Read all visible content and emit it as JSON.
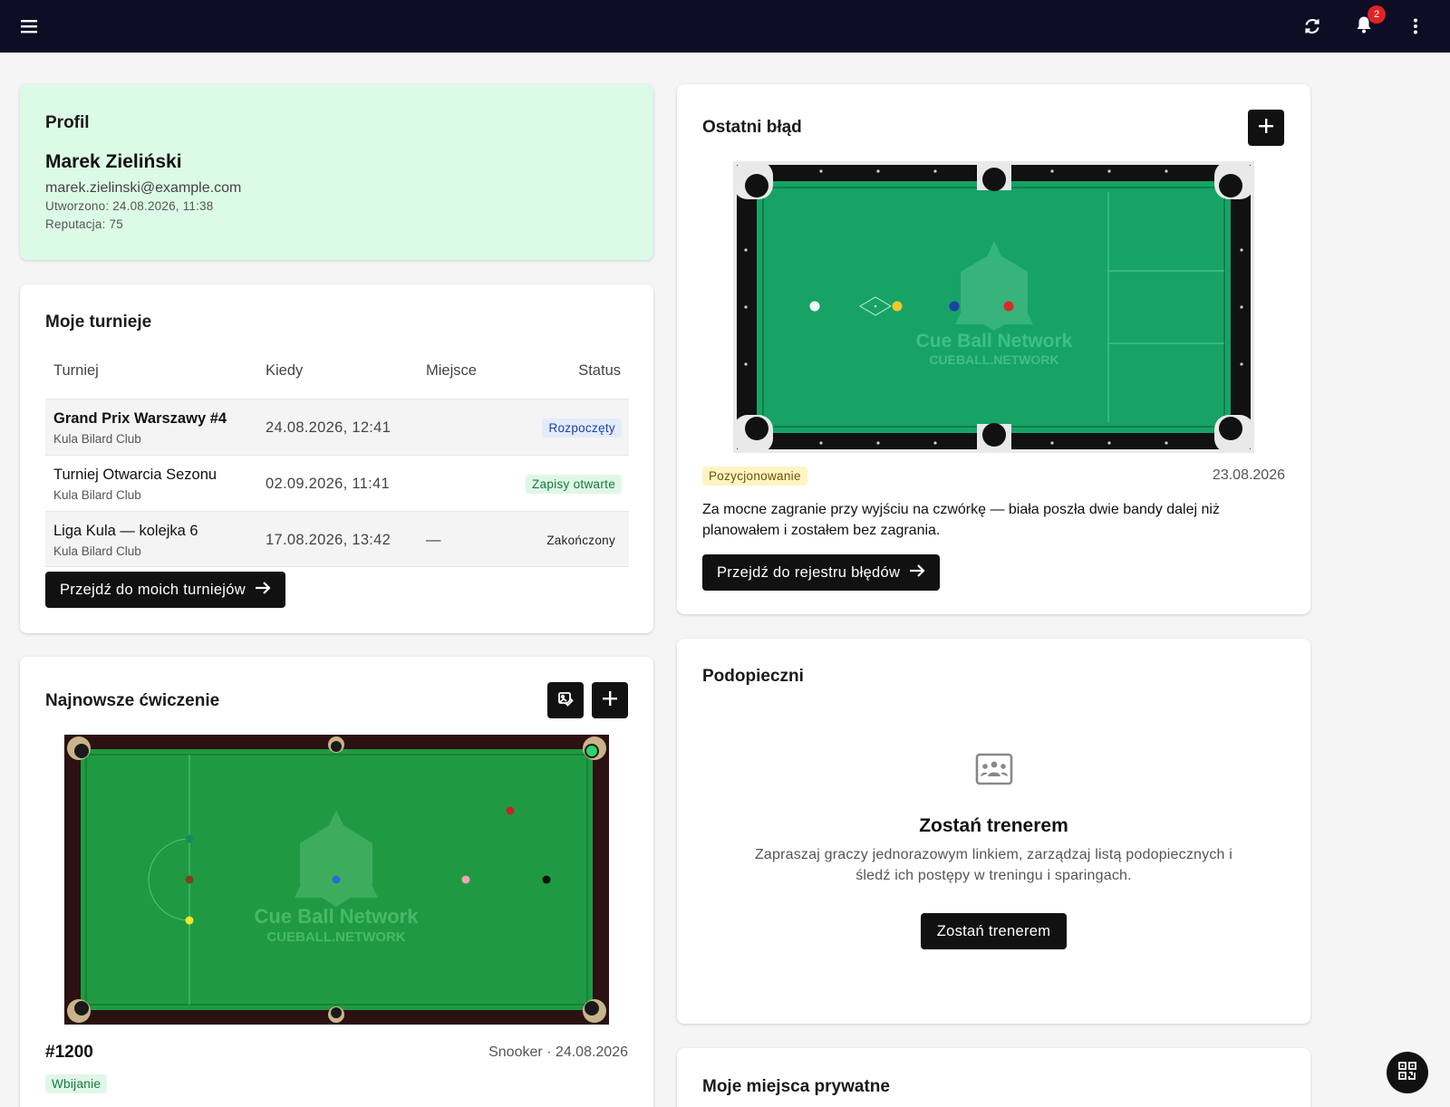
{
  "topbar": {
    "menu_icon": "hamburger-icon",
    "refresh_icon": "refresh-icon",
    "notifications_icon": "bell-icon",
    "notifications_count": "2",
    "more_icon": "more-vertical-icon",
    "bg_color": "#0e0d26",
    "badge_color": "#e02424"
  },
  "profile": {
    "title": "Profil",
    "name": "Marek Zieliński",
    "email": "marek.zielinski@example.com",
    "created": "Utworzono: 24.08.2026, 11:38",
    "reputation": "Reputacja: 75",
    "bg_color": "#dcfbe6"
  },
  "tournaments": {
    "title": "Moje turnieje",
    "columns": [
      "Turniej",
      "Kiedy",
      "Miejsce",
      "Status"
    ],
    "rows": [
      {
        "name": "Grand Prix Warszawy #4",
        "club": "Kula Bilard Club",
        "when": "24.08.2026, 12:41",
        "place": "",
        "status": "Rozpoczęty",
        "status_color": "#1a3fa8",
        "status_bg": "#e3ecfb"
      },
      {
        "name": "Turniej Otwarcia Sezonu",
        "club": "Kula Bilard Club",
        "when": "02.09.2026, 11:41",
        "place": "",
        "status": "Zapisy otwarte",
        "status_color": "#137a3b",
        "status_bg": "#e0f7e7"
      },
      {
        "name": "Liga Kula — kolejka 6",
        "club": "Kula Bilard Club",
        "when": "17.08.2026, 13:42",
        "place": "—",
        "status": "Zakończony",
        "status_color": "#222222",
        "status_bg": "transparent"
      }
    ],
    "link_label": "Przejdź do moich turniejów"
  },
  "drill": {
    "title": "Najnowsze ćwiczenie",
    "edit_icon": "image-edit-icon",
    "add_icon": "plus-icon",
    "number": "#1200",
    "meta": "Snooker · 24.08.2026",
    "tag": "Wbijanie",
    "table_watermark_title": "Cue Ball Network",
    "table_watermark_sub": "CUEBALL.NETWORK",
    "felt_color": "#1f9a43"
  },
  "mistake": {
    "title": "Ostatni błąd",
    "add_icon": "plus-icon",
    "tag": "Pozycjonowanie",
    "date": "23.08.2026",
    "text": "Za mocne zagranie przy wyjściu na czwórkę — biała poszła dwie bandy dalej niż planowałem i zostałem bez zagrania.",
    "link_label": "Przejdź do rejestru błędów",
    "table_watermark_title": "Cue Ball Network",
    "table_watermark_sub": "CUEBALL.NETWORK",
    "felt_color": "#17a366"
  },
  "pupils": {
    "title": "Podopieczni",
    "empty_icon": "group-card-icon",
    "heading": "Zostań trenerem",
    "desc_line1": "Zapraszaj graczy jednorazowym linkiem, zarządzaj listą podopiecznych i",
    "desc_line2": "śledź ich postępy w treningu i sparingach.",
    "button_label": "Zostań trenerem"
  },
  "private_places": {
    "title": "Moje miejsca prywatne"
  },
  "fab": {
    "icon": "qr-code-icon"
  }
}
